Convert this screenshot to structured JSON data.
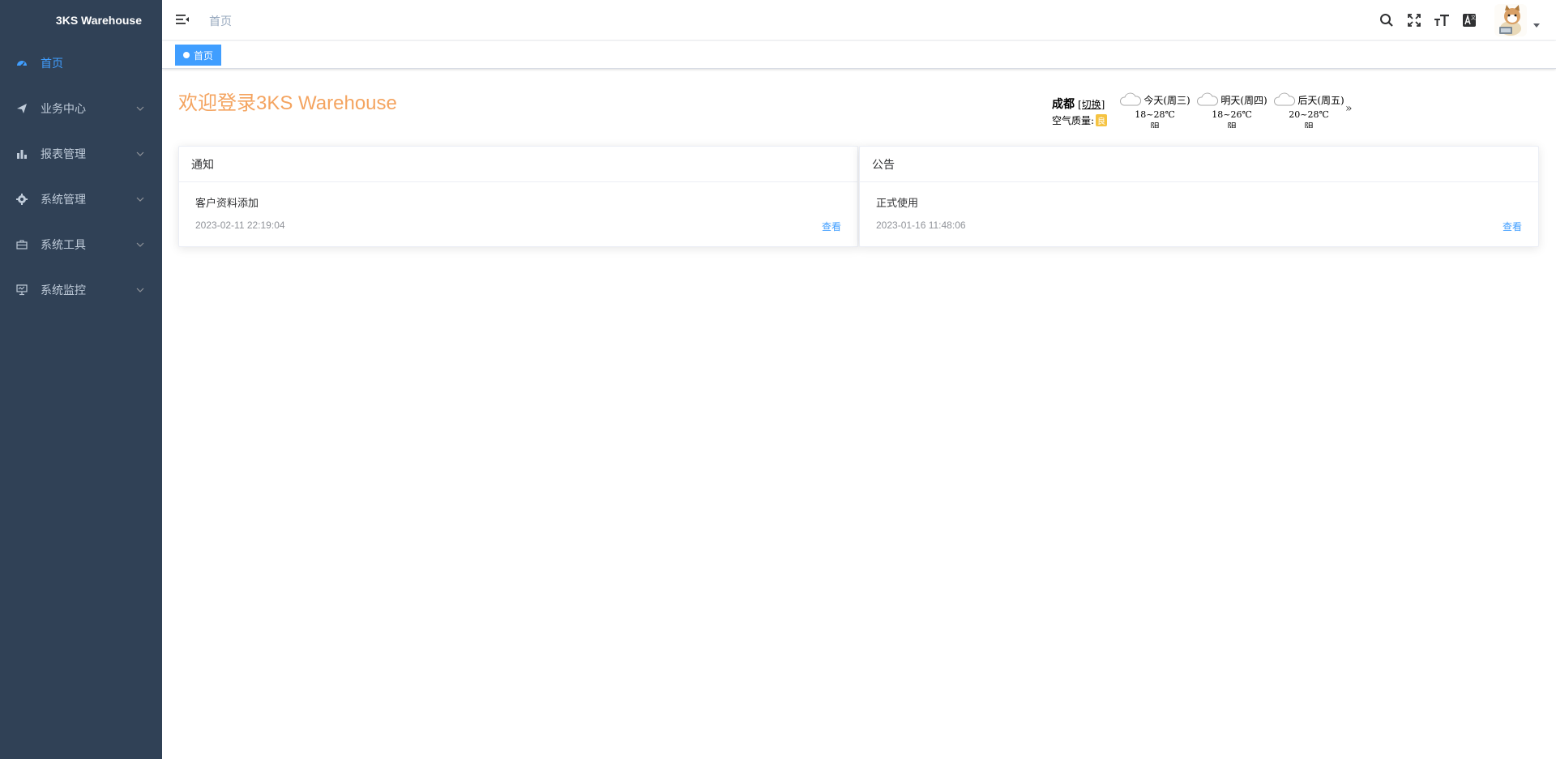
{
  "app": {
    "title": "3KS Warehouse"
  },
  "sidebar": {
    "items": [
      {
        "label": "首页",
        "icon": "dashboard-icon",
        "active": true
      },
      {
        "label": "业务中心",
        "icon": "send-icon",
        "active": false
      },
      {
        "label": "报表管理",
        "icon": "bar-chart-icon",
        "active": false
      },
      {
        "label": "系统管理",
        "icon": "gear-icon",
        "active": false
      },
      {
        "label": "系统工具",
        "icon": "toolbox-icon",
        "active": false
      },
      {
        "label": "系统监控",
        "icon": "monitor-icon",
        "active": false
      }
    ]
  },
  "header": {
    "breadcrumb": "首页",
    "icons": [
      "search-icon",
      "fullscreen-icon",
      "font-size-icon",
      "translate-icon"
    ]
  },
  "tags": {
    "active": "首页"
  },
  "main": {
    "welcome": "欢迎登录3KS Warehouse"
  },
  "weather": {
    "city": "成都",
    "switch": "[切换]",
    "air_label": "空气质量:",
    "air_value": "良",
    "more": "»",
    "days": [
      {
        "name": "今天(周三)",
        "temp": "18~28℃",
        "cond": "阴"
      },
      {
        "name": "明天(周四)",
        "temp": "18~26℃",
        "cond": "阴"
      },
      {
        "name": "后天(周五)",
        "temp": "20~28℃",
        "cond": "阴"
      }
    ]
  },
  "notice": {
    "title": "通知",
    "item_title": "客户资料添加",
    "item_date": "2023-02-11 22:19:04",
    "link": "查看"
  },
  "announcement": {
    "title": "公告",
    "item_title": "正式使用",
    "item_date": "2023-01-16 11:48:06",
    "link": "查看"
  },
  "colors": {
    "sidebar_bg": "#304156",
    "accent": "#409eff",
    "welcome": "#f4a460"
  }
}
